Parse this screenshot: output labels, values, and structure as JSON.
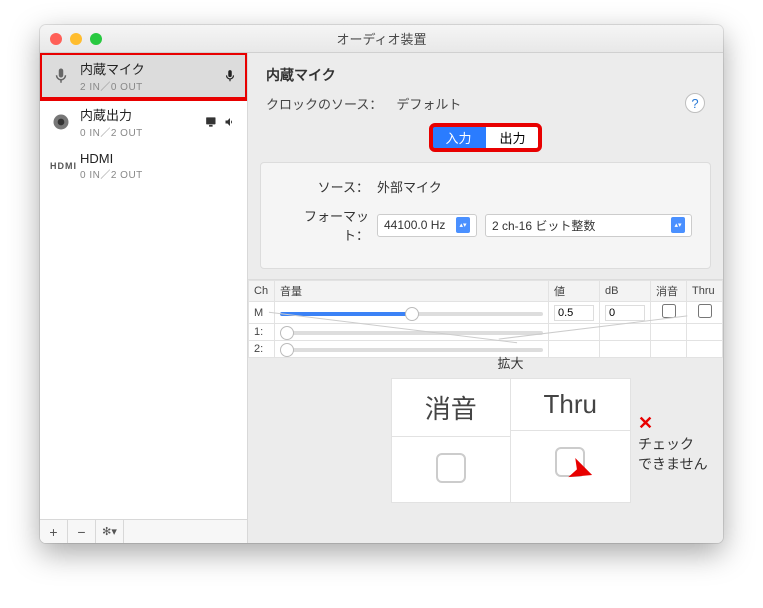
{
  "window": {
    "title": "オーディオ装置"
  },
  "sidebar": {
    "devices": [
      {
        "name": "内蔵マイク",
        "io": "2 IN／0 OUT",
        "selected": true,
        "right_icon": "mic"
      },
      {
        "name": "内蔵出力",
        "io": "0 IN／2 OUT",
        "selected": false,
        "right_icon": "speaker"
      },
      {
        "name": "HDMI",
        "io": "0 IN／2 OUT",
        "selected": false,
        "icon_label": "HDMI"
      }
    ],
    "footer": {
      "add": "+",
      "remove": "−",
      "gear": "✻▾"
    }
  },
  "content": {
    "device_title": "内蔵マイク",
    "clock": {
      "label": "クロックのソース：",
      "value": "デフォルト"
    },
    "help": "?",
    "tabs": {
      "input": "入力",
      "output": "出力",
      "active": "input"
    },
    "panel": {
      "source": {
        "label": "ソース：",
        "value": "外部マイク"
      },
      "format": {
        "label": "フォーマット：",
        "rate": "44100.0 Hz",
        "depth": "2 ch-16 ビット整数"
      }
    },
    "table": {
      "headers": {
        "ch": "Ch",
        "vol": "音量",
        "val": "値",
        "db": "dB",
        "mute": "消音",
        "thru": "Thru"
      },
      "rows": [
        {
          "ch": "M",
          "slider": 50,
          "enabled": true,
          "val": "0.5",
          "db": "0",
          "mute": false,
          "thru": false
        },
        {
          "ch": "1:",
          "slider": 0,
          "enabled": false,
          "val": "",
          "db": "",
          "mute": false,
          "thru": false
        },
        {
          "ch": "2:",
          "slider": 0,
          "enabled": false,
          "val": "",
          "db": "",
          "mute": false,
          "thru": false
        }
      ]
    }
  },
  "zoom": {
    "label": "拡大",
    "col1": "消音",
    "col2": "Thru",
    "annot_x": "✕",
    "annot_line1": "チェック",
    "annot_line2": "できません"
  }
}
